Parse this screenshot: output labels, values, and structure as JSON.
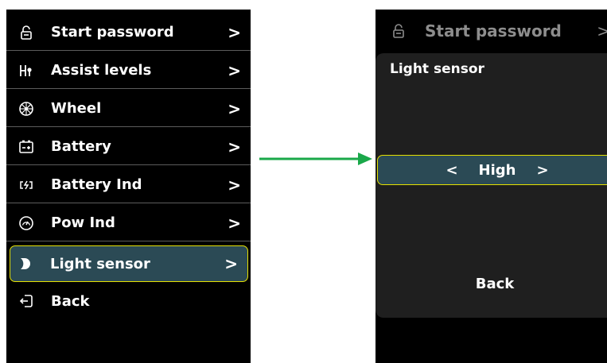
{
  "left_menu": {
    "items": [
      {
        "icon": "lock-icon",
        "label": "Start password",
        "chevron": ">"
      },
      {
        "icon": "assist-levels-icon",
        "label": "Assist levels",
        "chevron": ">"
      },
      {
        "icon": "wheel-icon",
        "label": "Wheel",
        "chevron": ">"
      },
      {
        "icon": "battery-icon",
        "label": "Battery",
        "chevron": ">"
      },
      {
        "icon": "battery-indicator-icon",
        "label": "Battery Ind",
        "chevron": ">"
      },
      {
        "icon": "power-indicator-icon",
        "label": "Pow Ind",
        "chevron": ">"
      },
      {
        "icon": "light-sensor-icon",
        "label": "Light sensor",
        "chevron": ">"
      },
      {
        "icon": "back-icon",
        "label": "Back",
        "chevron": ""
      }
    ],
    "selected_index": 6
  },
  "right_screen": {
    "header": {
      "icon": "lock-icon",
      "label": "Start password",
      "chevron": ">"
    },
    "dialog": {
      "title": "Light sensor",
      "left_arrow": "<",
      "value": "High",
      "right_arrow": ">",
      "back_label": "Back"
    }
  },
  "colors": {
    "screen_bg": "#000000",
    "selection_bg": "#2b4a55",
    "selection_border": "#e5e000",
    "arrow": "#1aa84a"
  }
}
